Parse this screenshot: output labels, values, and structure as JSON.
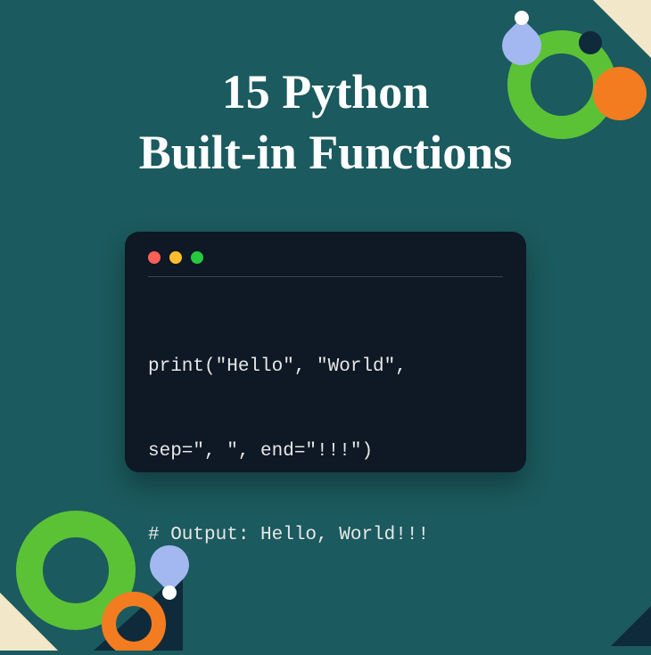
{
  "title": {
    "line1": "15 Python",
    "line2": "Built-in Functions"
  },
  "code": {
    "line1": "print(\"Hello\", \"World\",",
    "line2": "sep=\", \", end=\"!!!\")",
    "line3": "# Output: Hello, World!!!"
  },
  "colors": {
    "background": "#1b5a5e",
    "windowBg": "#0f1825",
    "accentGreen": "#5bc236",
    "accentOrange": "#f47c20",
    "accentPurple": "#a3b8f0",
    "accentCream": "#f2e7c9"
  }
}
